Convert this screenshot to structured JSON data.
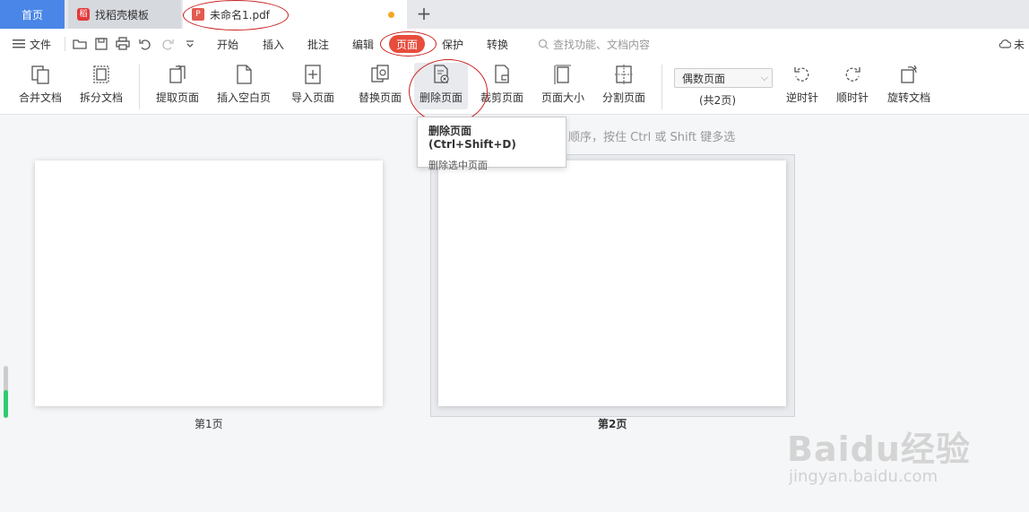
{
  "tabs": {
    "home": "首页",
    "template": "找稻壳模板",
    "document": "未命名1.pdf",
    "add": "+"
  },
  "menubar": {
    "file": "文件",
    "tabs": [
      "开始",
      "插入",
      "批注",
      "编辑",
      "页面",
      "保护",
      "转换"
    ],
    "active": "页面",
    "search_placeholder": "查找功能、文档内容",
    "cloud": "未"
  },
  "toolbar": {
    "buttons": [
      {
        "label": "合并文档",
        "icon": "merge-document-icon"
      },
      {
        "label": "拆分文档",
        "icon": "split-document-icon"
      },
      {
        "label": "提取页面",
        "icon": "extract-page-icon"
      },
      {
        "label": "插入空白页",
        "icon": "insert-blank-page-icon"
      },
      {
        "label": "导入页面",
        "icon": "import-page-icon"
      },
      {
        "label": "替换页面",
        "icon": "replace-page-icon"
      },
      {
        "label": "删除页面",
        "icon": "delete-page-icon"
      },
      {
        "label": "裁剪页面",
        "icon": "crop-page-icon"
      },
      {
        "label": "页面大小",
        "icon": "page-size-icon"
      },
      {
        "label": "分割页面",
        "icon": "divide-page-icon"
      },
      {
        "label": "逆时针",
        "icon": "rotate-ccw-icon"
      },
      {
        "label": "顺时针",
        "icon": "rotate-cw-icon"
      },
      {
        "label": "旋转文档",
        "icon": "rotate-document-icon"
      }
    ],
    "page_select": "偶数页面",
    "page_count": "(共2页)"
  },
  "tooltip": {
    "title": "删除页面 (Ctrl+Shift+D)",
    "desc": "删除选中页面"
  },
  "hint": "顺序，按住 Ctrl 或 Shift 键多选",
  "pages": [
    {
      "label": "第1页"
    },
    {
      "label": "第2页"
    }
  ],
  "watermark": {
    "brand": "Baidu经验",
    "url": "jingyan.baidu.com"
  },
  "colors": {
    "accent_blue": "#4a86e8",
    "active_red": "#e74c3c",
    "annotation_red": "#c9201f"
  }
}
